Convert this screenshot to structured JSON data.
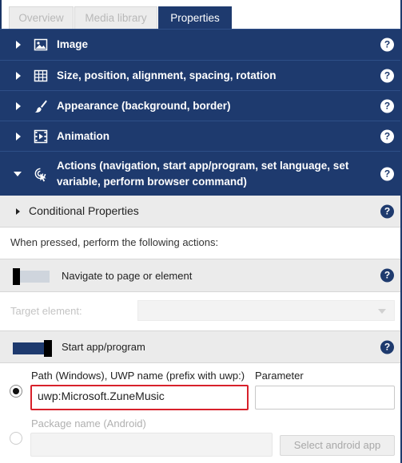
{
  "tabs": [
    {
      "label": "Overview",
      "active": false
    },
    {
      "label": "Media library",
      "active": false
    },
    {
      "label": "Properties",
      "active": true
    }
  ],
  "sections": {
    "image": {
      "label": "Image",
      "icon": "image-icon"
    },
    "size": {
      "label": "Size, position, alignment, spacing, rotation",
      "icon": "layout-grid-icon"
    },
    "appearance": {
      "label": "Appearance (background, border)",
      "icon": "brush-icon"
    },
    "animation": {
      "label": "Animation",
      "icon": "film-icon"
    },
    "actions": {
      "label_line1": "Actions (navigation, start app/program, set language, set",
      "label_line2": "variable, perform browser command)",
      "icon": "touch-icon"
    }
  },
  "help_glyph": "?",
  "conditional": {
    "label": "Conditional Properties"
  },
  "when_pressed": "When pressed, perform the following actions:",
  "navigate": {
    "label": "Navigate to page or element",
    "enabled": false,
    "target_label": "Target element:"
  },
  "start_app": {
    "label": "Start app/program",
    "enabled": true,
    "path_label": "Path (Windows), UWP name (prefix with uwp:)",
    "path_value": "uwp:Microsoft.ZuneMusic",
    "parameter_label": "Parameter",
    "parameter_value": "",
    "package_label": "Package name (Android)",
    "package_value": "",
    "select_android_label": "Select android app"
  },
  "colors": {
    "header": "#1e3a6e",
    "highlight": "#d8212b"
  }
}
